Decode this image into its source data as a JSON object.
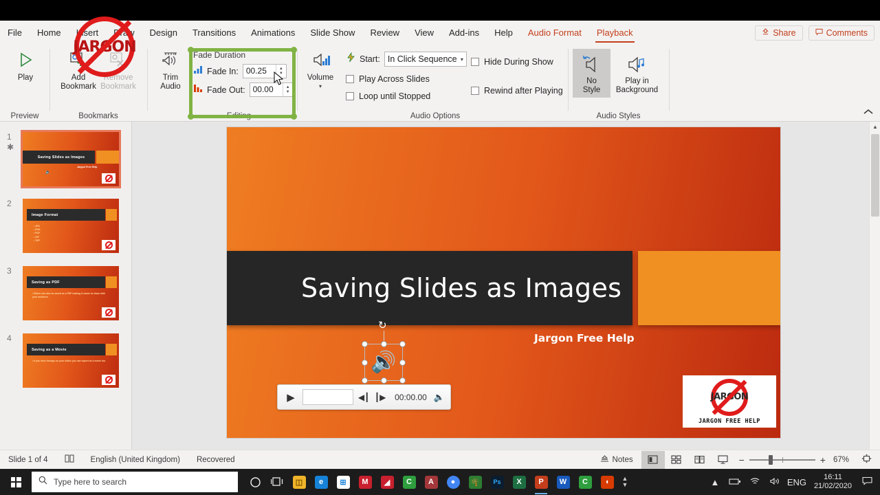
{
  "app": {
    "name": "PowerPoint",
    "ribbon_collapse_icon": "chevron-up-icon"
  },
  "tabs": [
    {
      "label": "File",
      "state": "normal"
    },
    {
      "label": "Home",
      "state": "normal"
    },
    {
      "label": "Insert",
      "state": "normal"
    },
    {
      "label": "Draw",
      "state": "normal"
    },
    {
      "label": "Design",
      "state": "normal"
    },
    {
      "label": "Transitions",
      "state": "normal"
    },
    {
      "label": "Animations",
      "state": "normal"
    },
    {
      "label": "Slide Show",
      "state": "normal"
    },
    {
      "label": "Review",
      "state": "normal"
    },
    {
      "label": "View",
      "state": "normal"
    },
    {
      "label": "Add-ins",
      "state": "normal"
    },
    {
      "label": "Help",
      "state": "normal"
    },
    {
      "label": "Audio Format",
      "state": "accent"
    },
    {
      "label": "Playback",
      "state": "active"
    }
  ],
  "titlebar_right": {
    "share_label": "Share",
    "share_icon": "share-person-icon",
    "comments_label": "Comments",
    "comments_icon": "comment-bubble-icon"
  },
  "ribbon": {
    "preview": {
      "group_label": "Preview",
      "play_label": "Play",
      "play_icon": "play-triangle-icon"
    },
    "bookmarks": {
      "group_label": "Bookmarks",
      "add_label": "Add\nBookmark",
      "add_line1": "Add",
      "add_line2": "Bookmark",
      "add_icon": "add-bookmark-icon",
      "remove_line1": "Remove",
      "remove_line2": "Bookmark",
      "remove_icon": "remove-bookmark-icon",
      "remove_disabled": true
    },
    "editing": {
      "group_label": "Editing",
      "trim_line1": "Trim",
      "trim_line2": "Audio",
      "trim_icon": "trim-audio-icon",
      "fade_duration_label": "Fade Duration",
      "fade_in_label": "Fade In:",
      "fade_in_value": "00.25",
      "fade_in_icon": "fade-in-bars-icon",
      "fade_out_label": "Fade Out:",
      "fade_out_value": "00.00",
      "fade_out_icon": "fade-out-bars-icon"
    },
    "audio_options": {
      "group_label": "Audio Options",
      "volume_label": "Volume",
      "volume_icon": "volume-speaker-icon",
      "volume_dropdown_icon": "chevron-down-icon",
      "start_label": "Start:",
      "start_icon": "lightning-start-icon",
      "start_value": "In Click Sequence",
      "start_dropdown_icon": "chevron-down-icon",
      "checkboxes": [
        {
          "label": "Play Across Slides",
          "checked": false
        },
        {
          "label": "Loop until Stopped",
          "checked": false
        },
        {
          "label": "Hide During Show",
          "checked": false
        },
        {
          "label": "Rewind after Playing",
          "checked": false
        }
      ]
    },
    "audio_styles": {
      "group_label": "Audio Styles",
      "no_style_line1": "No",
      "no_style_line2": "Style",
      "no_style_icon": "no-style-speaker-icon",
      "no_style_selected": true,
      "play_bg_line1": "Play in",
      "play_bg_line2": "Background",
      "play_bg_icon": "play-background-speaker-icon"
    }
  },
  "thumbnails": [
    {
      "number": "1",
      "selected": true,
      "animation_marker": "✱",
      "title": "Saving Slides as Images",
      "subtitle": "Jargon Free Help",
      "bullets": [],
      "has_audio_icon": true
    },
    {
      "number": "2",
      "selected": false,
      "animation_marker": "",
      "title": "Image Format",
      "subtitle": "",
      "bullets": [
        "JPG",
        "PNG",
        "PDF",
        "GIF",
        "TIFF"
      ],
      "has_audio_icon": false
    },
    {
      "number": "3",
      "selected": false,
      "animation_marker": "",
      "title": "Saving as PDF",
      "subtitle": "",
      "bullets": [
        "Slides can also be saved as a PDF making it easier to share with your audience"
      ],
      "has_audio_icon": false
    },
    {
      "number": "4",
      "selected": false,
      "animation_marker": "",
      "title": "Saving as a Movie",
      "subtitle": "",
      "bullets": [
        "If you have timings on your slides you can export as a movie too"
      ],
      "has_audio_icon": false
    }
  ],
  "slide": {
    "title": "Saving Slides as Images",
    "subtitle": "Jargon Free Help",
    "logo": {
      "word": "JARGON",
      "caption": "JARGON FREE HELP",
      "ring_color": "#e01b1b"
    },
    "audio_object": {
      "speaker_icon": "audio-speaker-icon",
      "rotate_icon": "rotate-handle-icon",
      "selected": true
    },
    "player": {
      "play_icon": "play-icon",
      "prev_icon": "step-back-icon",
      "next_icon": "step-forward-icon",
      "time": "00:00.00",
      "volume_icon": "volume-icon"
    },
    "colors": {
      "gradient_start": "#ef7d22",
      "gradient_end": "#bb2a0f",
      "title_bar": "#262626",
      "accent_block": "#f09022"
    }
  },
  "statusbar": {
    "slide_counter": "Slide 1 of 4",
    "accessibility_icon": "accessibility-book-icon",
    "language": "English (United Kingdom)",
    "recovered": "Recovered",
    "notes_label": "Notes",
    "notes_icon": "notes-icon",
    "views": [
      {
        "name": "normal-view",
        "icon": "normal-view-icon",
        "active": true
      },
      {
        "name": "slide-sorter-view",
        "icon": "slide-sorter-icon",
        "active": false
      },
      {
        "name": "reading-view",
        "icon": "reading-view-icon",
        "active": false
      },
      {
        "name": "slide-show-view",
        "icon": "slide-show-icon",
        "active": false
      }
    ],
    "zoom_out_icon": "minus-icon",
    "zoom_in_icon": "plus-icon",
    "zoom_level": "67%",
    "fit_slide_icon": "fit-to-window-icon"
  },
  "taskbar": {
    "start_icon": "windows-logo-icon",
    "search_icon": "search-icon",
    "search_placeholder": "Type here to search",
    "cortana_icon": "cortana-circle-icon",
    "taskview_icon": "task-view-icon",
    "apps": [
      {
        "name": "file-explorer",
        "glyph": "☰",
        "color": "#f0b429",
        "running": false
      },
      {
        "name": "microsoft-edge",
        "glyph": "e",
        "color": "#1783d8",
        "running": false
      },
      {
        "name": "microsoft-store",
        "glyph": "⊞",
        "color": "#ffffff",
        "running": false
      },
      {
        "name": "adobe-reader",
        "glyph": "M",
        "color": "#c8202e",
        "running": false
      },
      {
        "name": "snagit-editor",
        "glyph": "◧",
        "color": "#c8202e",
        "running": false
      },
      {
        "name": "camtasia",
        "glyph": "C",
        "color": "#2e9e3e",
        "running": false
      },
      {
        "name": "microsoft-access",
        "glyph": "A",
        "color": "#a4373a",
        "running": false
      },
      {
        "name": "google-chrome",
        "glyph": "●",
        "color": "#4285f4",
        "running": false
      },
      {
        "name": "pinterest",
        "glyph": "✿",
        "color": "#e60023",
        "running": false
      },
      {
        "name": "adobe-photoshop",
        "glyph": "Ps",
        "color": "#0b1d2e",
        "running": false
      },
      {
        "name": "microsoft-excel",
        "glyph": "X",
        "color": "#1d6f42",
        "running": false
      },
      {
        "name": "microsoft-powerpoint",
        "glyph": "P",
        "color": "#c43e1c",
        "running": true
      },
      {
        "name": "microsoft-word",
        "glyph": "W",
        "color": "#185abd",
        "running": false
      },
      {
        "name": "camtasia-recorder",
        "glyph": "C",
        "color": "#2e9e3e",
        "running": false
      },
      {
        "name": "microsoft-office",
        "glyph": "◖",
        "color": "#d83b01",
        "running": false
      }
    ],
    "overflow_icon": "show-hidden-icons-icon",
    "tray": [
      {
        "name": "battery-icon",
        "glyph": "▭"
      },
      {
        "name": "wifi-icon",
        "glyph": "◠"
      },
      {
        "name": "speaker-icon",
        "glyph": "◂"
      }
    ],
    "language_indicator": "ENG",
    "clock_time": "16:11",
    "clock_date": "21/02/2020",
    "action_center_icon": "notification-icon"
  },
  "annotations": {
    "highlight_color": "#7bb03b",
    "stamp_word": "JARGON",
    "stamp_color": "#e01b1b"
  }
}
